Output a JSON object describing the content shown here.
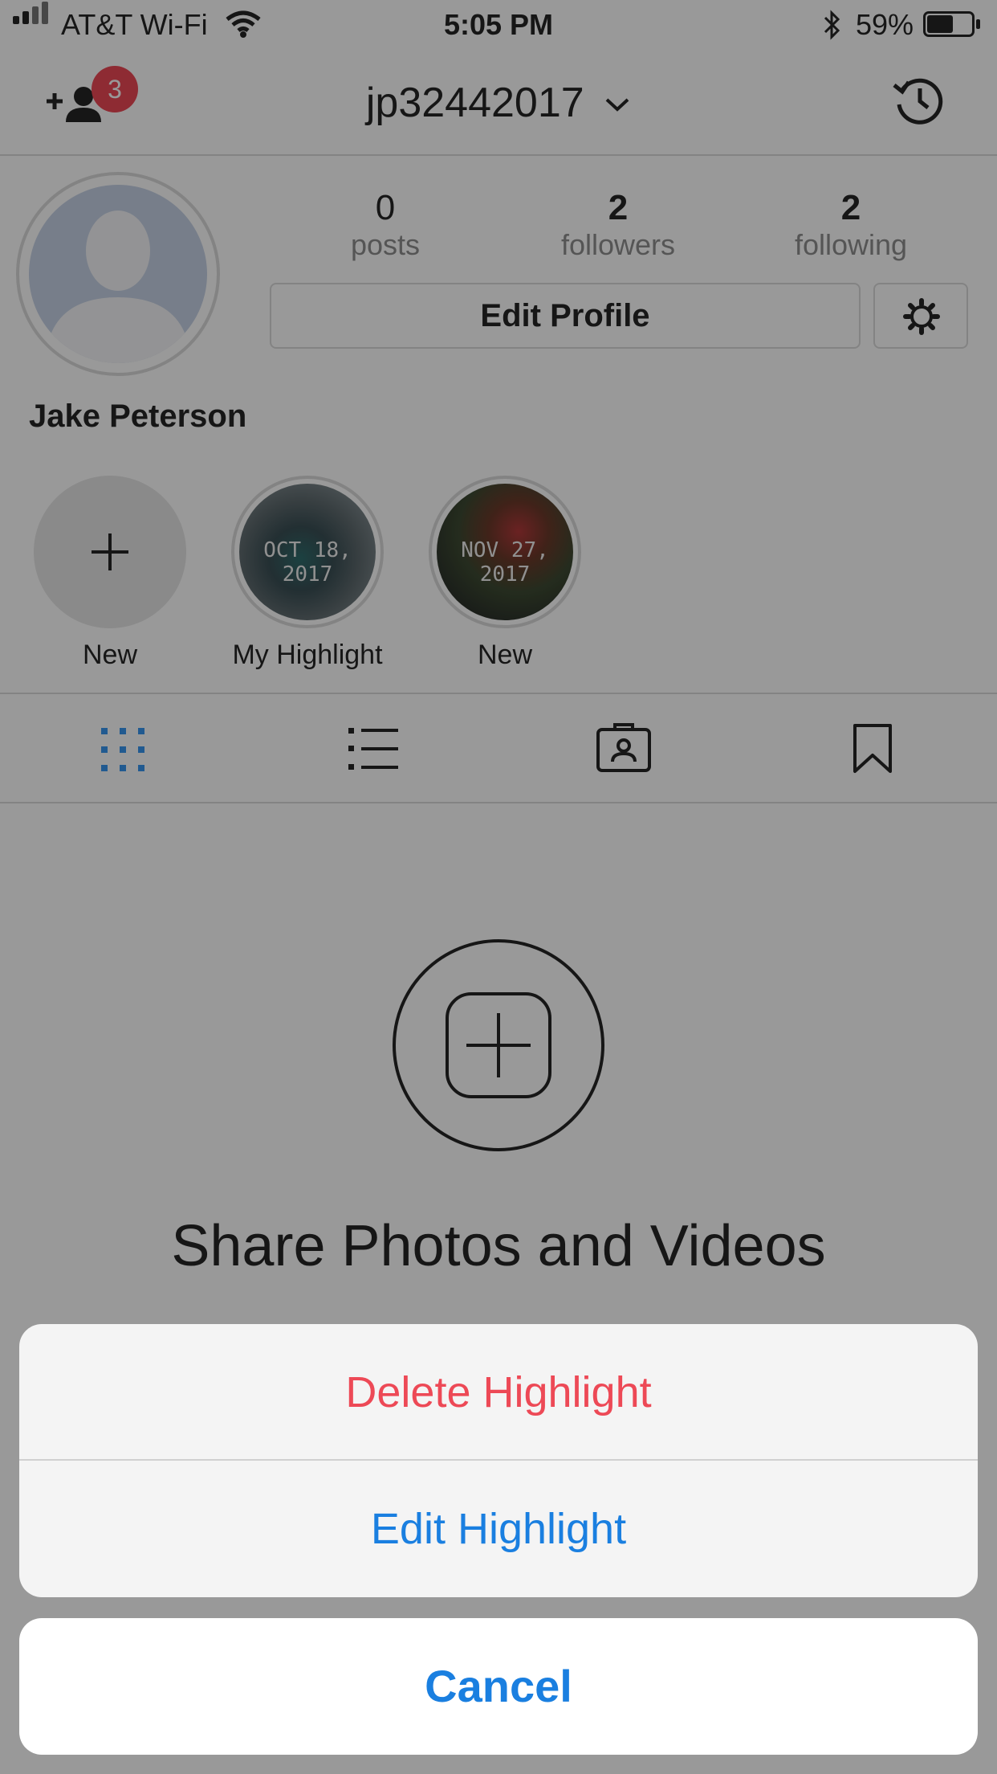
{
  "status_bar": {
    "carrier": "AT&T Wi-Fi",
    "time": "5:05 PM",
    "battery": "59%"
  },
  "header": {
    "username": "jp32442017",
    "badge_count": "3"
  },
  "profile": {
    "stats": [
      {
        "value": "0",
        "label": "posts"
      },
      {
        "value": "2",
        "label": "followers"
      },
      {
        "value": "2",
        "label": "following"
      }
    ],
    "edit_label": "Edit Profile",
    "full_name": "Jake Peterson"
  },
  "highlights": [
    {
      "label": "New",
      "cover_text": ""
    },
    {
      "label": "My Highlight",
      "cover_text": "OCT 18, 2017"
    },
    {
      "label": "New",
      "cover_text": "NOV 27, 2017"
    }
  ],
  "empty_state": {
    "title": "Share Photos and Videos"
  },
  "action_sheet": {
    "delete_label": "Delete Highlight",
    "edit_label": "Edit Highlight",
    "cancel_label": "Cancel"
  },
  "colors": {
    "destructive": "#ed4956",
    "action": "#1a7fe0",
    "tab_active": "#3897f0"
  },
  "icons": [
    "signal-icon",
    "wifi-icon",
    "bluetooth-icon",
    "battery-icon",
    "add-person-icon",
    "chevron-down-icon",
    "history-icon",
    "gear-icon",
    "plus-icon",
    "grid-icon",
    "list-icon",
    "tagged-icon",
    "bookmark-icon",
    "add-post-icon"
  ]
}
